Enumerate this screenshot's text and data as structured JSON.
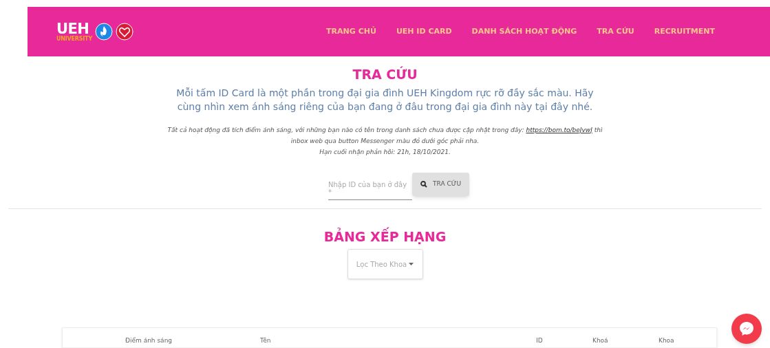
{
  "header": {
    "logo": {
      "text": "UEH",
      "subtext": "UNIVERSITY"
    },
    "nav": [
      {
        "label": "TRANG CHỦ"
      },
      {
        "label": "UEH ID CARD"
      },
      {
        "label": "DANH SÁCH HOẠT ĐỘNG"
      },
      {
        "label": "TRA CỨU"
      },
      {
        "label": "RECRUITMENT"
      }
    ]
  },
  "lookup": {
    "title": "TRA CỨU",
    "intro": "Mỗi tấm ID Card là một phần trong đại gia đình UEH Kingdom rực rỡ đầy sắc màu. Hãy cùng nhìn xem ánh sáng riêng của bạn đang ở đâu trong đại gia đình này tại đây nhé.",
    "note_before": "Tất cả hoạt động đã tích điểm ánh sáng, với những bạn nào có tên trong danh sách chưa được cập nhật trong đây:",
    "note_link": "https://bom.to/beJvwJ",
    "note_after": "thì inbox web qua button Messenger màu đỏ dưới góc phải nha.",
    "deadline": "Hạn cuối nhận phản hồi: 21h, 18/10/2021.",
    "search": {
      "placeholder": "Nhập ID của bạn ở đây *",
      "button": "TRA CỨU"
    }
  },
  "ranking": {
    "title": "BẢNG XẾP HẠNG",
    "filter": "Lọc Theo Khoa",
    "columns": [
      {
        "label": "Điểm ánh sáng"
      },
      {
        "label": "Tên"
      },
      {
        "label": "ID"
      },
      {
        "label": "Khoá"
      },
      {
        "label": "Khoa"
      }
    ]
  }
}
